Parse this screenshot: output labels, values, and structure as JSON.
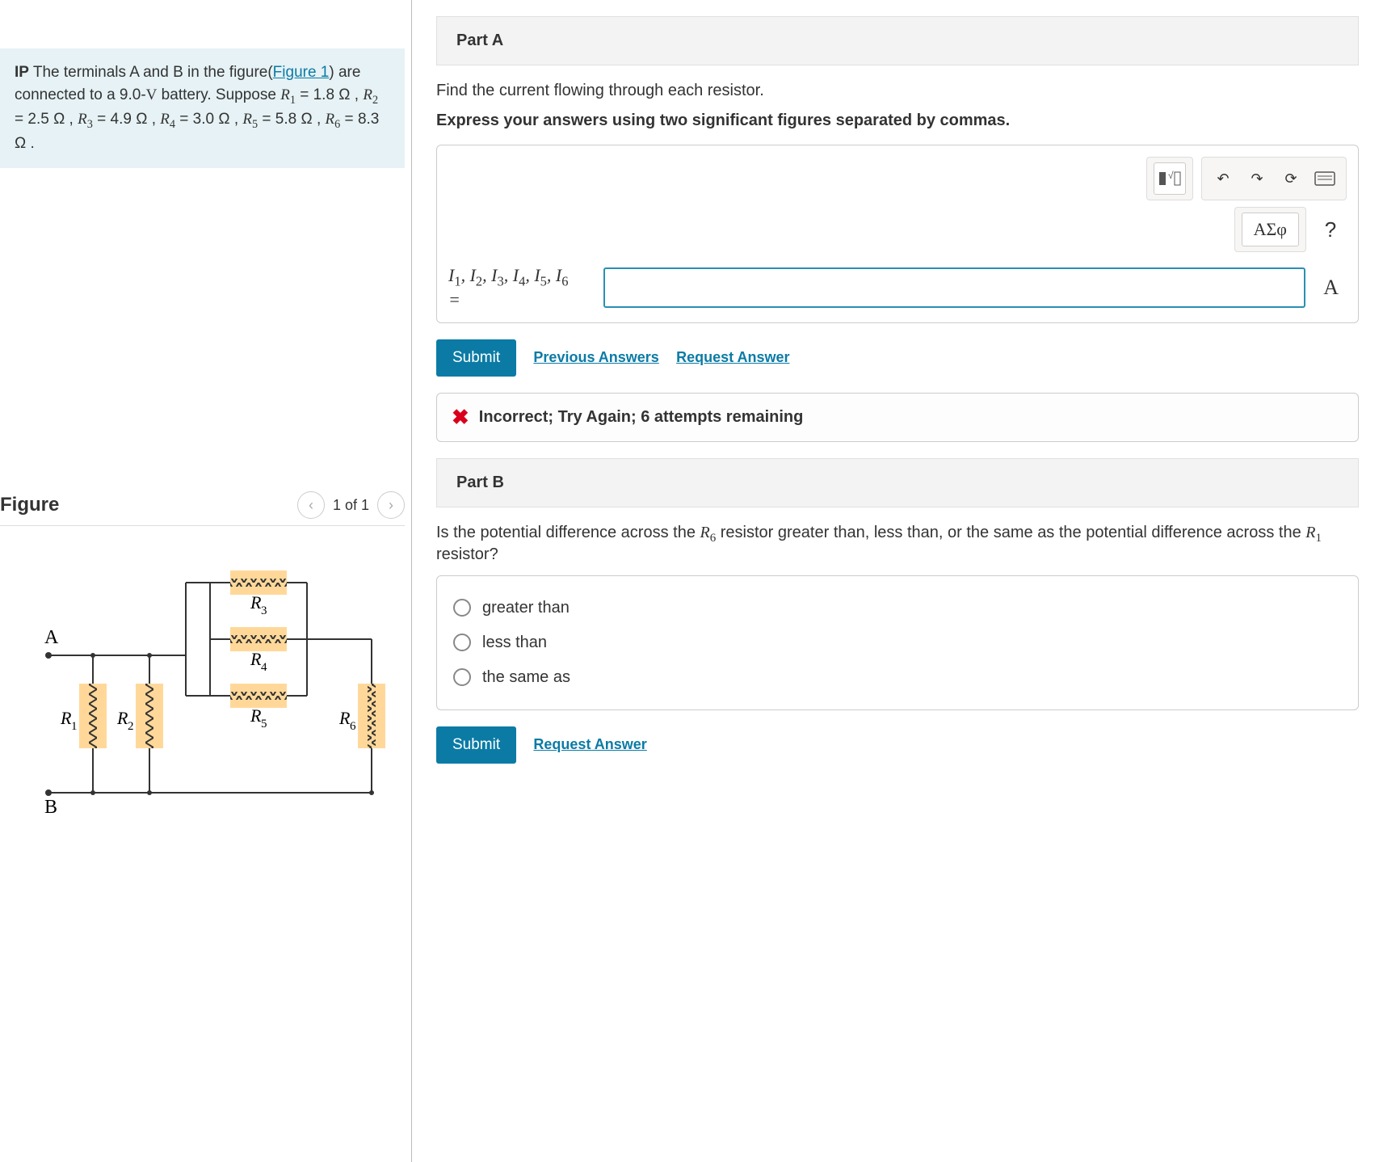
{
  "problem": {
    "prefix": "IP",
    "text_1": " The terminals A and B in the figure(",
    "figure_link": "Figure 1",
    "text_2": ") are connected to a 9.0-",
    "voltage_unit": "V",
    "text_3": " battery. Suppose ",
    "r1": "1.8 Ω",
    "r2": "2.5 Ω",
    "r3": "4.9 Ω",
    "r4": "3.0 Ω",
    "r5": "5.8 Ω",
    "r6": "8.3 Ω"
  },
  "figure": {
    "title": "Figure",
    "counter": "1 of 1",
    "labels": {
      "A": "A",
      "B": "B",
      "R1": "R",
      "R2": "R",
      "R3": "R",
      "R4": "R",
      "R5": "R",
      "R6": "R"
    }
  },
  "partA": {
    "header": "Part A",
    "prompt": "Find the current flowing through each resistor.",
    "instruction": "Express your answers using two significant figures separated by commas.",
    "greek_btn": "ΑΣφ",
    "var_label_line1": "I₁, I₂, I₃, I₄, I₅, I₆",
    "var_label_line2": "= ",
    "unit": "A",
    "submit": "Submit",
    "prev": "Previous Answers",
    "request": "Request Answer",
    "feedback": "Incorrect; Try Again; 6 attempts remaining"
  },
  "partB": {
    "header": "Part B",
    "prompt_1": "Is the potential difference across the ",
    "prompt_r6": "R₆",
    "prompt_2": " resistor greater than, less than, or the same as the potential difference across the ",
    "prompt_r1": "R₁",
    "prompt_3": " resistor?",
    "options": [
      "greater than",
      "less than",
      "the same as"
    ],
    "submit": "Submit",
    "request": "Request Answer"
  }
}
